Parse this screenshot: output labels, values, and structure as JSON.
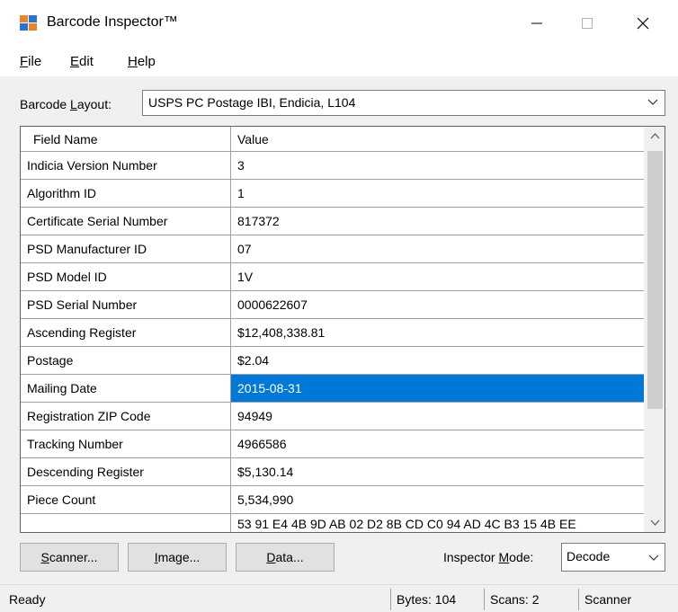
{
  "window": {
    "title": "Barcode Inspector™",
    "minimize_glyph": "—",
    "maximize_glyph": "☐",
    "close_glyph": "✕"
  },
  "menu": {
    "file": {
      "underlined": "F",
      "rest": "ile"
    },
    "edit": {
      "underlined": "E",
      "rest": "dit"
    },
    "help": {
      "underlined": "H",
      "rest": "elp"
    }
  },
  "layout_selector": {
    "label_pre": "Barcode ",
    "label_underlined": "L",
    "label_post": "ayout:",
    "value": "USPS PC Postage IBI, Endicia, L104"
  },
  "table": {
    "columns": [
      "Field Name",
      "Value"
    ],
    "rows": [
      {
        "name": "Indicia Version Number",
        "value": "3"
      },
      {
        "name": "Algorithm ID",
        "value": "1"
      },
      {
        "name": "Certificate Serial Number",
        "value": "817372"
      },
      {
        "name": "PSD Manufacturer ID",
        "value": "07"
      },
      {
        "name": "PSD Model ID",
        "value": "1V"
      },
      {
        "name": "PSD Serial Number",
        "value": "0000622607"
      },
      {
        "name": "Ascending Register",
        "value": "$12,408,338.81"
      },
      {
        "name": "Postage",
        "value": "$2.04"
      },
      {
        "name": "Mailing Date",
        "value": "2015-08-31"
      },
      {
        "name": "Registration ZIP Code",
        "value": "94949"
      },
      {
        "name": "Tracking Number",
        "value": "4966586"
      },
      {
        "name": "Descending Register",
        "value": "$5,130.14"
      },
      {
        "name": "Piece Count",
        "value": "5,534,990"
      }
    ],
    "selected_row_index": 8,
    "partial_row": {
      "name": "",
      "value": "53 91 E4 4B 9D AB 02 D2 8B CD C0 94 AD 4C B3 15 4B EE"
    }
  },
  "buttons": {
    "scanner": {
      "underlined": "S",
      "rest": "canner..."
    },
    "image": {
      "underlined": "I",
      "rest": "mage..."
    },
    "data": {
      "underlined": "D",
      "rest": "ata..."
    }
  },
  "inspector_mode": {
    "label_pre": "Inspector ",
    "label_underlined": "M",
    "label_post": "ode:",
    "value": "Decode"
  },
  "status": {
    "state": "Ready",
    "bytes": "Bytes: 104",
    "scans": "Scans: 2",
    "source": "Scanner"
  },
  "colors": {
    "selection": "#0078d7",
    "window_bg": "#f0f0f0",
    "button_bg": "#e1e1e1"
  }
}
